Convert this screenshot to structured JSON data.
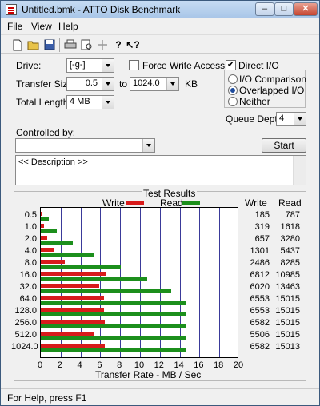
{
  "window": {
    "title": "Untitled.bmk - ATTO Disk Benchmark"
  },
  "menu": [
    "File",
    "View",
    "Help"
  ],
  "toolbar_icons": [
    "new-icon",
    "open-icon",
    "save-icon",
    "print-icon",
    "print-preview-icon",
    "move-icon",
    "help-icon",
    "context-help-icon"
  ],
  "form": {
    "drive_label": "Drive:",
    "drive_value": "[-g-]",
    "force_write_label": "Force Write Access",
    "force_write_checked": false,
    "direct_io_label": "Direct I/O",
    "direct_io_checked": true,
    "transfer_size_label": "Transfer Size:",
    "transfer_from": "0.5",
    "to_label": "to",
    "transfer_to": "1024.0",
    "kb_label": "KB",
    "total_length_label": "Total Length:",
    "total_length": "4 MB",
    "radio_io_comparison": "I/O Comparison",
    "radio_overlapped": "Overlapped I/O",
    "radio_neither": "Neither",
    "selected_io_mode": "Overlapped I/O",
    "queue_depth_label": "Queue Depth:",
    "queue_depth": "4",
    "controlled_by_label": "Controlled by:",
    "controlled_by_value": "",
    "start_label": "Start",
    "description": "<< Description >>"
  },
  "results": {
    "title": "Test Results",
    "legend_write": "Write",
    "legend_read": "Read",
    "col_write": "Write",
    "col_read": "Read",
    "xlabel": "Transfer Rate - MB / Sec",
    "colors": {
      "write": "#d81b1b",
      "read": "#1c8f1c"
    }
  },
  "chart_data": {
    "type": "bar",
    "title": "Test Results",
    "xlabel": "Transfer Rate - MB / Sec",
    "xlim": [
      0,
      20
    ],
    "xticks": [
      "0",
      "2",
      "4",
      "6",
      "8",
      "10",
      "12",
      "14",
      "16",
      "18",
      "20"
    ],
    "categories": [
      "0.5",
      "1.0",
      "2.0",
      "4.0",
      "8.0",
      "16.0",
      "32.0",
      "64.0",
      "128.0",
      "256.0",
      "512.0",
      "1024.0"
    ],
    "series": [
      {
        "name": "Write",
        "values": [
          185,
          319,
          657,
          1301,
          2486,
          6812,
          6020,
          6553,
          6553,
          6582,
          5506,
          6582
        ]
      },
      {
        "name": "Read",
        "values": [
          787,
          1618,
          3280,
          5437,
          8285,
          10985,
          13463,
          15015,
          15015,
          15015,
          15015,
          15013
        ]
      }
    ]
  },
  "status": {
    "text": "For Help, press F1"
  }
}
